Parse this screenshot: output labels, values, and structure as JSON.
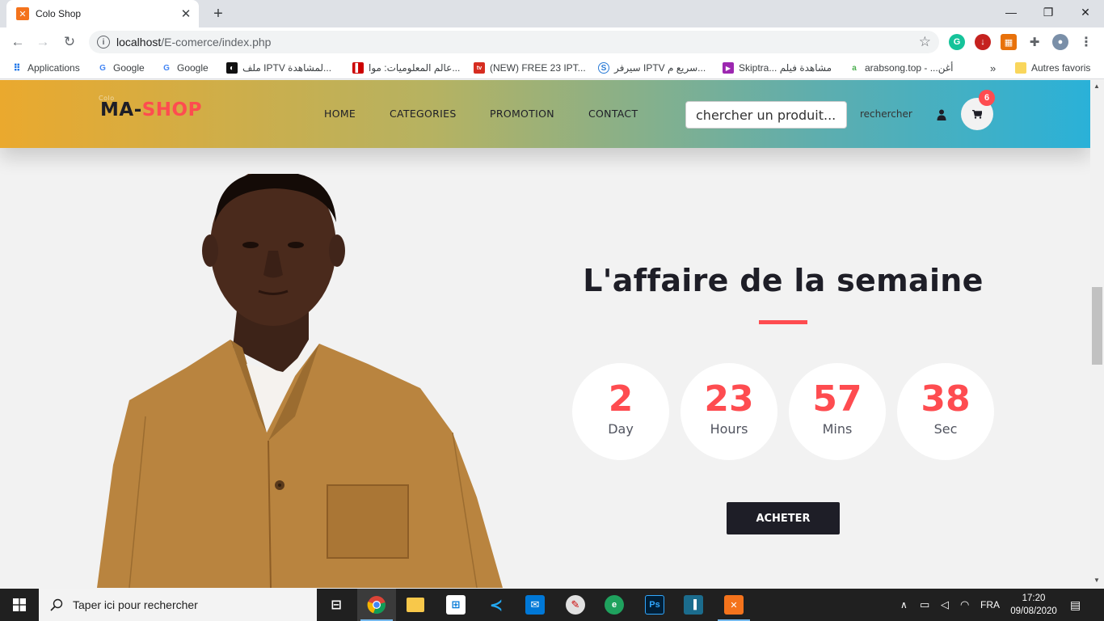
{
  "browser": {
    "tab_title": "Colo Shop",
    "url_host": "localhost",
    "url_path": "/E-comerce/index.php",
    "bookmarks": [
      "Applications",
      "Google",
      "Google",
      "ملف IPTV لمشاهدة...",
      "عالم المعلوميات: موا...",
      "(NEW) FREE 23 IPT...",
      "سيرفر IPTV سريع م...",
      "Skiptra... مشاهدة فيلم",
      "arabsong.top - ...أغن",
      "Autres favoris"
    ]
  },
  "site": {
    "logo_small": "Colo",
    "logo_part1": "MA-",
    "logo_part2": "SHOP",
    "nav": [
      "HOME",
      "CATEGORIES",
      "PROMOTION",
      "CONTACT"
    ],
    "search_placeholder": "chercher un produit....",
    "search_button": "rechercher",
    "cart_count": "6",
    "brand_colors": {
      "accent": "#fe4c50",
      "dark": "#1e1e27"
    }
  },
  "deal": {
    "title": "L'affaire de la semaine",
    "timer": [
      {
        "value": "2",
        "label": "Day"
      },
      {
        "value": "23",
        "label": "Hours"
      },
      {
        "value": "57",
        "label": "Mins"
      },
      {
        "value": "38",
        "label": "Sec"
      }
    ],
    "button": "ACHETER"
  },
  "taskbar": {
    "search_text": "Taper ici pour rechercher",
    "language": "FRA",
    "time": "17:20",
    "date": "09/08/2020"
  }
}
